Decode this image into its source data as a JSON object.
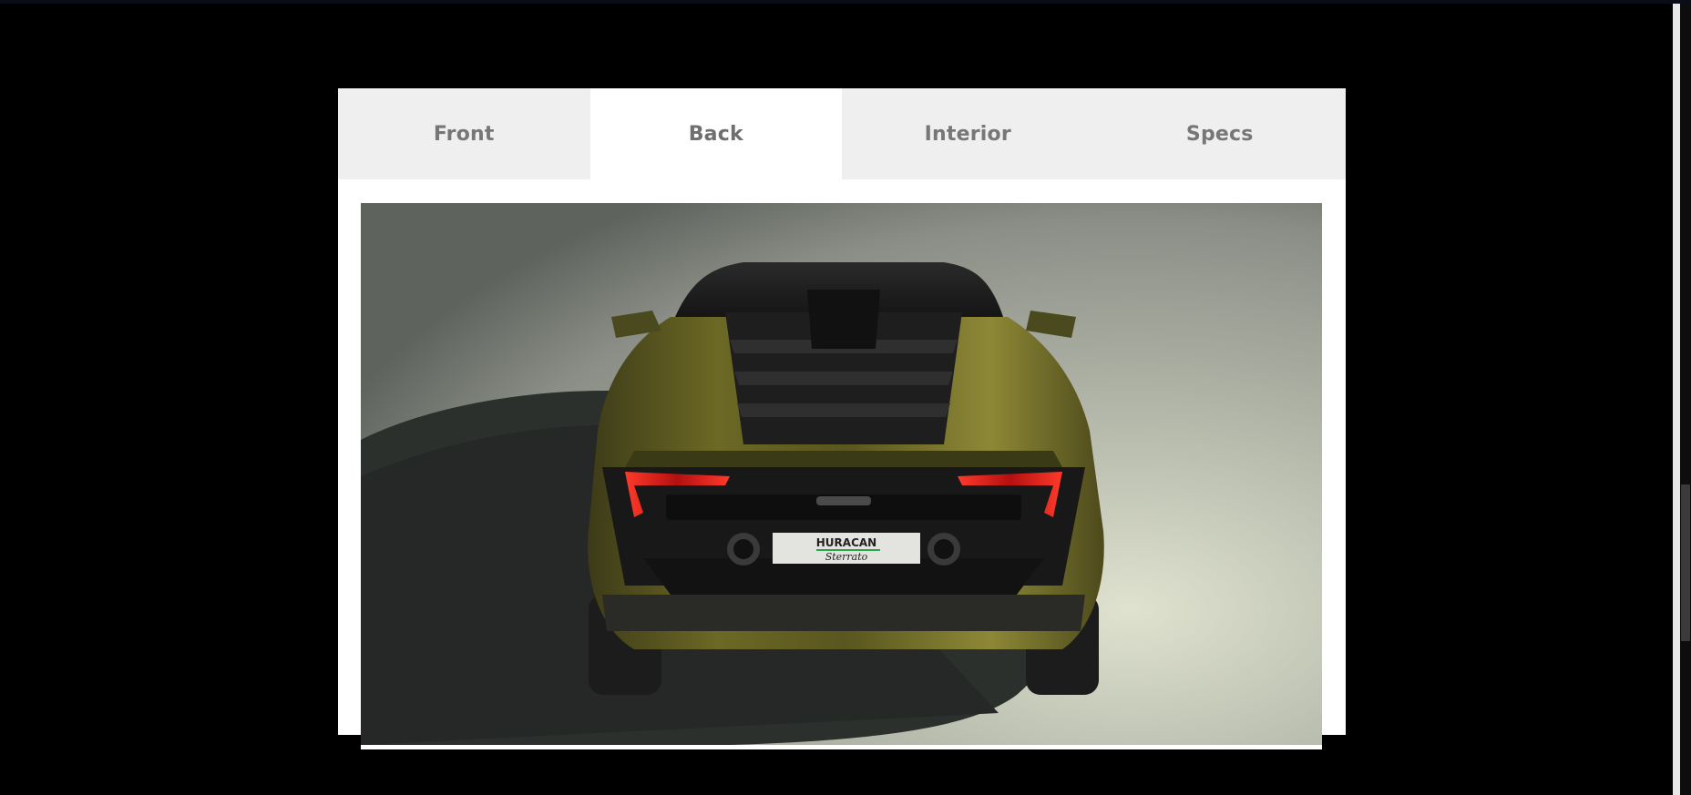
{
  "gallery": {
    "tabs": [
      {
        "label": "Front",
        "active": false
      },
      {
        "label": "Back",
        "active": true
      },
      {
        "label": "Interior",
        "active": false
      },
      {
        "label": "Specs",
        "active": false
      }
    ],
    "image": {
      "plate_line1": "HURACAN",
      "plate_line2": "Sterrato"
    }
  },
  "colors": {
    "tab_inactive_bg": "#efefef",
    "tab_active_bg": "#ffffff",
    "tab_text": "#777777",
    "car_body": "#6e6a25",
    "taillight": "#d01818"
  }
}
